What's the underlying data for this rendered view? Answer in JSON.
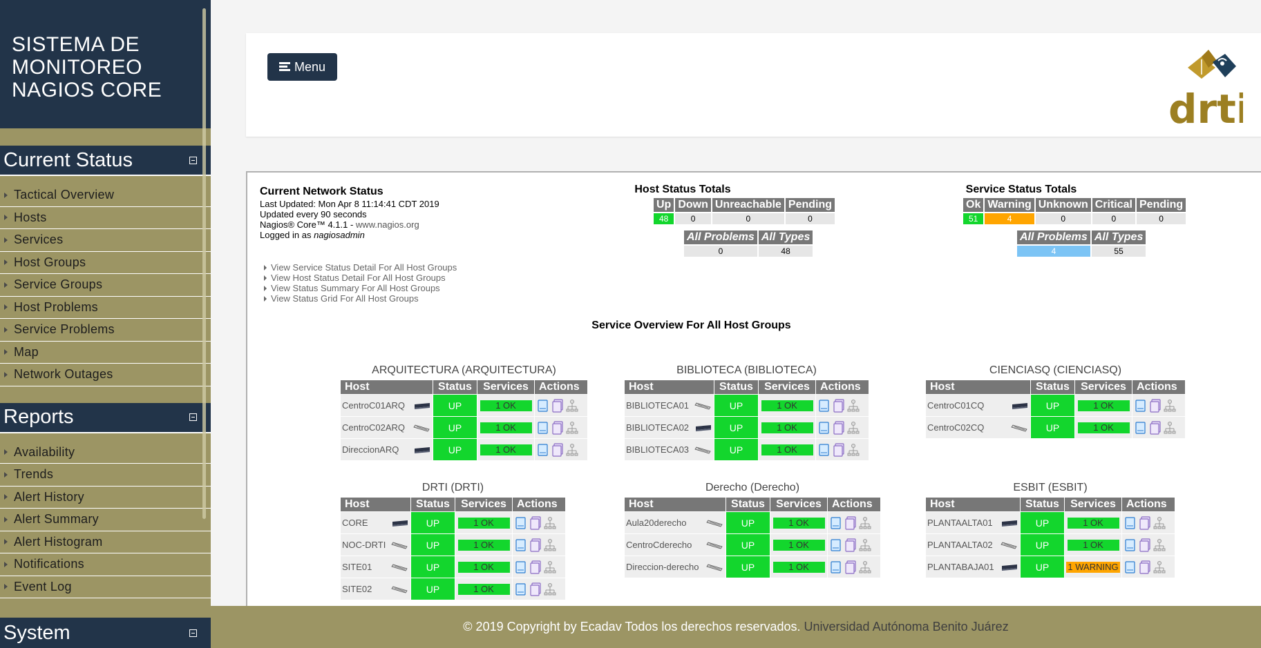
{
  "brand": {
    "line1": "SISTEMA DE",
    "line2": "MONITOREO",
    "line3": "NAGIOS CORE"
  },
  "sidebar": {
    "sections": [
      {
        "title": "Current Status",
        "items": [
          "Tactical Overview",
          "Hosts",
          "Services",
          "Host Groups",
          "Service Groups",
          "Host Problems",
          "Service Problems",
          "Map",
          "Network Outages"
        ]
      },
      {
        "title": "Reports",
        "items": [
          "Availability",
          "Trends",
          "Alert History",
          "Alert Summary",
          "Alert Histogram",
          "Notifications",
          "Event Log"
        ]
      },
      {
        "title": "System"
      }
    ]
  },
  "header": {
    "menu_label": "Menu",
    "logo_text": "drti"
  },
  "network_status": {
    "title": "Current Network Status",
    "last_updated": "Last Updated: Mon Apr 8 11:14:41 CDT 2019",
    "update_interval": "Updated every 90 seconds",
    "version_prefix": "Nagios® Core™ 4.1.1 - ",
    "version_link": "www.nagios.org",
    "logged_prefix": "Logged in as ",
    "logged_user": "nagiosadmin"
  },
  "links": [
    "View Service Status Detail For All Host Groups",
    "View Host Status Detail For All Host Groups",
    "View Status Summary For All Host Groups",
    "View Status Grid For All Host Groups"
  ],
  "host_totals": {
    "title": "Host Status Totals",
    "headers": [
      "Up",
      "Down",
      "Unreachable",
      "Pending"
    ],
    "values": [
      "48",
      "0",
      "0",
      "0"
    ],
    "sub_headers": [
      "All Problems",
      "All Types"
    ],
    "sub_values": [
      "0",
      "48"
    ]
  },
  "service_totals": {
    "title": "Service Status Totals",
    "headers": [
      "Ok",
      "Warning",
      "Unknown",
      "Critical",
      "Pending"
    ],
    "values": [
      "51",
      "4",
      "0",
      "0",
      "0"
    ],
    "sub_headers": [
      "All Problems",
      "All Types"
    ],
    "sub_values": [
      "4",
      "55"
    ]
  },
  "overview_title": "Service Overview For All Host Groups",
  "table_headers": {
    "host": "Host",
    "status": "Status",
    "services": "Services",
    "actions": "Actions"
  },
  "host_groups": [
    {
      "title": "ARQUITECTURA (ARQUITECTURA)",
      "hosts": [
        {
          "name": "CentroC01ARQ",
          "device": "switch",
          "status": "UP",
          "services": "1 OK",
          "svc_state": "ok"
        },
        {
          "name": "CentroC02ARQ",
          "device": "router",
          "status": "UP",
          "services": "1 OK",
          "svc_state": "ok"
        },
        {
          "name": "DireccionARQ",
          "device": "switch",
          "status": "UP",
          "services": "1 OK",
          "svc_state": "ok"
        }
      ]
    },
    {
      "title": "BIBLIOTECA (BIBLIOTECA)",
      "hosts": [
        {
          "name": "BIBLIOTECA01",
          "device": "router",
          "status": "UP",
          "services": "1 OK",
          "svc_state": "ok"
        },
        {
          "name": "BIBLIOTECA02",
          "device": "switch",
          "status": "UP",
          "services": "1 OK",
          "svc_state": "ok"
        },
        {
          "name": "BIBLIOTECA03",
          "device": "router",
          "status": "UP",
          "services": "1 OK",
          "svc_state": "ok"
        }
      ]
    },
    {
      "title": "CIENCIASQ (CIENCIASQ)",
      "hosts": [
        {
          "name": "CentroC01CQ",
          "device": "switch",
          "status": "UP",
          "services": "1 OK",
          "svc_state": "ok"
        },
        {
          "name": "CentroC02CQ",
          "device": "router",
          "status": "UP",
          "services": "1 OK",
          "svc_state": "ok"
        }
      ]
    },
    {
      "title": "DRTI (DRTI)",
      "hosts": [
        {
          "name": "CORE",
          "device": "switch",
          "status": "UP",
          "services": "1 OK",
          "svc_state": "ok"
        },
        {
          "name": "NOC-DRTI",
          "device": "router",
          "status": "UP",
          "services": "1 OK",
          "svc_state": "ok"
        },
        {
          "name": "SITE01",
          "device": "router",
          "status": "UP",
          "services": "1 OK",
          "svc_state": "ok"
        },
        {
          "name": "SITE02",
          "device": "router",
          "status": "UP",
          "services": "1 OK",
          "svc_state": "ok"
        }
      ]
    },
    {
      "title": "Derecho (Derecho)",
      "hosts": [
        {
          "name": "Aula20derecho",
          "device": "router",
          "status": "UP",
          "services": "1 OK",
          "svc_state": "ok"
        },
        {
          "name": "CentroCderecho",
          "device": "router",
          "status": "UP",
          "services": "1 OK",
          "svc_state": "ok"
        },
        {
          "name": "Direccion-derecho",
          "device": "router",
          "status": "UP",
          "services": "1 OK",
          "svc_state": "ok"
        }
      ]
    },
    {
      "title": "ESBIT (ESBIT)",
      "hosts": [
        {
          "name": "PLANTAALTA01",
          "device": "switch",
          "status": "UP",
          "services": "1 OK",
          "svc_state": "ok"
        },
        {
          "name": "PLANTAALTA02",
          "device": "router",
          "status": "UP",
          "services": "1 OK",
          "svc_state": "ok"
        },
        {
          "name": "PLANTABAJA01",
          "device": "switch",
          "status": "UP",
          "services": "1 WARNING",
          "svc_state": "warning"
        }
      ]
    }
  ],
  "footer": {
    "copyright": "© 2019 Copyright by Ecadav Todos los derechos reservados.",
    "university": "Universidad Autónoma Benito Juárez"
  },
  "colors": {
    "navy": "#223449",
    "olive": "#9c9564",
    "ok_green": "#13d62d",
    "warning_orange": "#ffa500",
    "problem_blue": "#7cc4f5"
  }
}
